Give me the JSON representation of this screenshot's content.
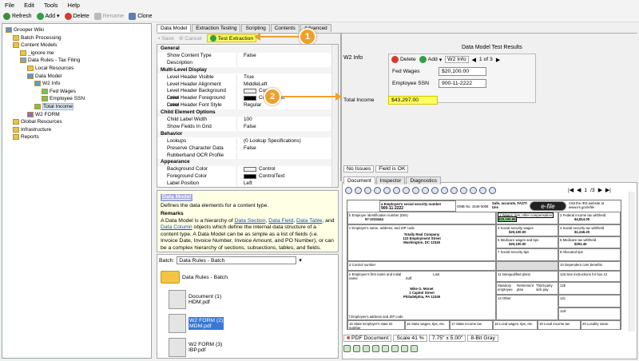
{
  "menu": [
    "File",
    "Edit",
    "Tools",
    "Help"
  ],
  "toolbar": {
    "refresh": "Refresh",
    "add": "Add",
    "delete": "Delete",
    "rename": "Rename",
    "clone": "Clone"
  },
  "tree": [
    {
      "label": "Grooper Wiki",
      "indent": 0
    },
    {
      "label": "Batch Processing",
      "indent": 1
    },
    {
      "label": "Content Models",
      "indent": 1
    },
    {
      "label": "_ignore me",
      "indent": 2
    },
    {
      "label": "Data Rules - Tax Filing",
      "indent": 2
    },
    {
      "label": "Local Resources",
      "indent": 3
    },
    {
      "label": "Data Model",
      "indent": 3
    },
    {
      "label": "W2 Info",
      "indent": 4
    },
    {
      "label": "Fed Wages",
      "indent": 5
    },
    {
      "label": "Employee SSN",
      "indent": 5
    },
    {
      "label": "Total Income",
      "indent": 4
    },
    {
      "label": "W2 FORM",
      "indent": 3
    },
    {
      "label": "Global Resources",
      "indent": 1
    },
    {
      "label": "Infrastructure",
      "indent": 1
    },
    {
      "label": "Reports",
      "indent": 1
    }
  ],
  "tabs": [
    "Data Model",
    "Extraction Testing",
    "Scripting",
    "Contents",
    "Advanced"
  ],
  "actions": {
    "save": "Save",
    "cancel": "Cancel",
    "test": "Test Extraction"
  },
  "props": [
    {
      "k": "General",
      "sec": true
    },
    {
      "k": "Show Content Type",
      "v": "False"
    },
    {
      "k": "Description",
      "v": ""
    },
    {
      "k": "Multi-Level Display",
      "sec": true
    },
    {
      "k": "Level Header Visible",
      "v": "True"
    },
    {
      "k": "Level Header Alignment",
      "v": "MiddleLeft"
    },
    {
      "k": "Level Header Background Color",
      "v": "Control",
      "sw": "#f0f0f0"
    },
    {
      "k": "Level Header Foreground Color",
      "v": "ControlText",
      "sw": "#000000"
    },
    {
      "k": "Level Header Font Style",
      "v": "Regular"
    },
    {
      "k": "Child Element Options",
      "sec": true
    },
    {
      "k": "Child Label Width",
      "v": "100"
    },
    {
      "k": "Show Fields In Grid",
      "v": "False"
    },
    {
      "k": "Behavior",
      "sec": true
    },
    {
      "k": "Lookups",
      "v": "(0 Lookup Specifications)"
    },
    {
      "k": "Preserve Character Data",
      "v": "False"
    },
    {
      "k": "Rubberband OCR Profile",
      "v": ""
    },
    {
      "k": "Appearance",
      "sec": true
    },
    {
      "k": "Background Color",
      "v": "Control",
      "sw": "#f0f0f0"
    },
    {
      "k": "Foreground Color",
      "v": "ControlText",
      "sw": "#000000"
    },
    {
      "k": "Label Position",
      "v": "Left"
    }
  ],
  "help": {
    "title": "Data Model",
    "desc": "Defines the data elements for a content type.",
    "remarks": "Remarks",
    "body_pre": "A Data Model is a hierarchy of ",
    "l1": "Data Section",
    "c1": ", ",
    "l2": "Data Field",
    "c2": ", ",
    "l3": "Data Table",
    "c3": ", and ",
    "l4": "Data Column",
    "body_post": " objects which define the internal data structure of a content type.  A Data Model can be as simple as a list of fields (i.e. Invoice Date, Invoice Number, Invoice Amount,  and PO Number), or can be a complex hierarchy of sections, subsections, tables, and fields."
  },
  "batch": {
    "label": "Batch:",
    "value": "Data Rules - Batch",
    "root": "Data Rules - Batch",
    "docs": [
      {
        "name": "Document (1)",
        "file": "HDM.pdf",
        "sel": false
      },
      {
        "name": "W2 FORM (2)",
        "file": "MDM.pdf",
        "sel": true
      },
      {
        "name": "W2 FORM (3)",
        "file": "IBP.pdf",
        "sel": false
      }
    ]
  },
  "results": {
    "title": "Data Model Test Results",
    "section": "W2 Info",
    "delete": "Delete",
    "add": "Add",
    "combo": "W2 Info",
    "pager": "1 of 3",
    "fields": [
      {
        "label": "Fed Wages",
        "value": "$20,100.00"
      },
      {
        "label": "Employee SSN",
        "value": "900-11-2222"
      }
    ],
    "total_label": "Total Income",
    "total_value": "$43,297.00"
  },
  "status": {
    "issues": "No Issues",
    "field": "Field is OK"
  },
  "doc_tabs": [
    "Document",
    "Inspector",
    "Diagnostics"
  ],
  "viewer": {
    "page": "1",
    "pages": "/3"
  },
  "w2": {
    "ssn_label": "a  Employee's social security number",
    "ssn": "900-11-2222",
    "omb": "OMB No. 1545-0008",
    "safe": "Safe, accurate, FAST! Use",
    "efile": "e-file",
    "irs": "Visit the IRS website at www.irs.gov/efile",
    "ein_label": "b  Employer identification number (EIN)",
    "ein": "97-2233444",
    "emp_label": "c  Employer's name, address, and ZIP code",
    "emp1": "Totally Real Company",
    "emp2": "123 Employment Street",
    "emp3": "Washington, DC 12345",
    "ctrl": "d  Control number",
    "ee_label": "e  Employee's first name and initial",
    "last": "Last name",
    "suff": "Suff.",
    "ee1": "Mike G. Monet",
    "ee2": "1 Capitol Street",
    "ee3": "Philadelphia, PA 12345",
    "ee_addr": "f  Employee's address and ZIP code",
    "b1": "1  Wages, tips, other compensation",
    "v1": "$20,100.00",
    "b2": "2  Federal income tax withheld",
    "v2": "$4,814.00",
    "b3": "3  Social security wages",
    "v3": "$20,100.00",
    "b4": "4  Social security tax withheld",
    "v4": "$1,246.20",
    "b5": "5  Medicare wages and tips",
    "v5": "$20,100.00",
    "b6": "6  Medicare tax withheld",
    "v6": "$291.45",
    "b7": "7  Social security tips",
    "b8": "8  Allocated tips",
    "b10": "10  Dependent care benefits",
    "b11": "11  Nonqualified plans",
    "b12a": "12a  See instructions for box 12",
    "b12b": "12b",
    "b12c": "12c",
    "b12d": "12d",
    "b13a": "Statutory employee",
    "b13b": "Retirement plan",
    "b13c": "Third-party sick pay",
    "b14": "14  Other",
    "b15": "15  State   Employer's state ID number",
    "b16": "16  State wages, tips, etc.",
    "b17": "17  State income tax",
    "b18": "18  Local wages, tips, etc.",
    "b19": "19  Local income tax",
    "b20": "20  Locality name"
  },
  "footer": {
    "type": "PDF Document",
    "scale": "Scale 41 %",
    "size": "7.75\" x 5.00\"",
    "bits": "8-Bit Gray"
  },
  "callouts": {
    "one": "1",
    "two": "2"
  },
  "colors": {
    "accent": "#f0a02a",
    "highlight": "#ffff5c",
    "link": "#1a4db3"
  }
}
